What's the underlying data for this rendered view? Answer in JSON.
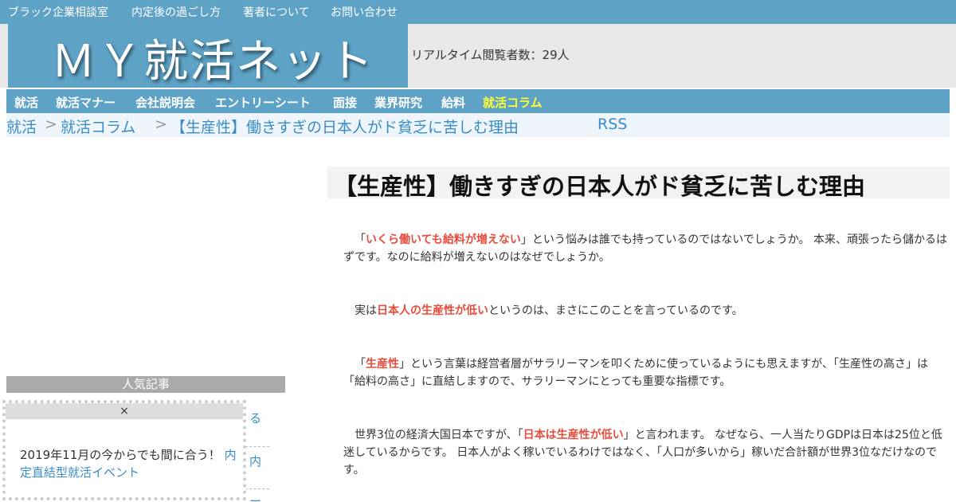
{
  "topbar": {
    "links": [
      "ブラック企業相談室",
      "内定後の過ごし方",
      "著者について",
      "お問い合わせ"
    ]
  },
  "header": {
    "logo": "ＭＹ就活ネット",
    "viewer_count": "リアルタイム閲覧者数：29人"
  },
  "nav": {
    "items": [
      "就活",
      "就活マナー",
      "会社説明会",
      "エントリーシート",
      "面接",
      "業界研究",
      "給料",
      "就活コラム"
    ]
  },
  "breadcrumb": {
    "home": "就活",
    "sep": ">",
    "category": "就活コラム",
    "current": "【生産性】働きすぎの日本人がド貧乏に苦しむ理由",
    "rss": "RSS"
  },
  "sidebar": {
    "popular_header": "人気記事",
    "peek1": "る",
    "peek2": "内",
    "peek3": "ー"
  },
  "popup": {
    "close": "×",
    "text": "2019年11月の今からでも間に合う！",
    "link": "内定直結型就活イベント"
  },
  "article": {
    "title": "【生産性】働きすぎの日本人がド貧乏に苦しむ理由",
    "p1": {
      "pre": "「",
      "hl": "いくら働いても給料が増えない",
      "post": "」という悩みは誰でも持っているのではないでしょうか。 本来、頑張ったら儲かるはずです。なのに給料が増えないのはなぜでしょうか。"
    },
    "p2": {
      "pre": "実は",
      "hl": "日本人の生産性が低い",
      "post": "というのは、まさにこのことを言っているのです。"
    },
    "p3": {
      "pre": "「",
      "hl": "生産性",
      "post": "」という言葉は経営者層がサラリーマンを叩くために使っているようにも思えますが、「生産性の高さ」は「給料の高さ」に直結しますので、サラリーマンにとっても重要な指標です。"
    },
    "p4": {
      "pre": "世界3位の経済大国日本ですが、「",
      "hl": "日本は生産性が低い",
      "post": "」と言われます。 なぜなら、一人当たりGDPは日本は25位と低迷しているからです。 日本人がよく稼いでいるわけではなく、「人口が多いから」稼いだ合計額が世界3位なだけなのです。"
    }
  },
  "colors": {
    "accent": "#5ea3c6",
    "highlight": "#e74c3c",
    "nav_active": "#ffff33",
    "link": "#3a8cc8"
  }
}
